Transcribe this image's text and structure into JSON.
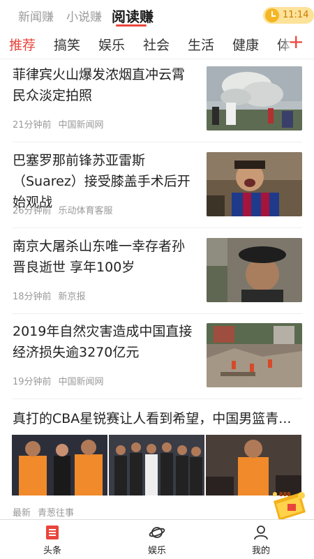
{
  "top_tabs": [
    "新闻赚",
    "小说赚",
    "阅读赚"
  ],
  "timer": {
    "time": "11:14"
  },
  "categories": [
    "推荐",
    "搞笑",
    "娱乐",
    "社会",
    "生活",
    "健康",
    "体"
  ],
  "add_symbol": "+",
  "articles": [
    {
      "title": "菲律宾火山爆发浓烟直冲云霄民众淡定拍照",
      "time": "21分钟前",
      "source": "中国新闻网"
    },
    {
      "title": "巴塞罗那前锋苏亚雷斯（Suarez）接受膝盖手术后开始观战",
      "time": "26分钟前",
      "source": "乐动体育客服"
    },
    {
      "title": "南京大屠杀山东唯一幸存者孙晋良逝世 享年100岁",
      "time": "18分钟前",
      "source": "新京报"
    },
    {
      "title": "2019年自然灾害造成中国直接经济损失逾3270亿元",
      "time": "19分钟前",
      "source": "中国新闻网"
    }
  ],
  "big_article": {
    "title": "真打的CBA星锐赛让人看到希望，中国男篮青...",
    "time": "最新",
    "source": "青葱往事"
  },
  "reward_badge": "888",
  "bottom_nav": [
    "头条",
    "娱乐",
    "我的"
  ],
  "colors": {
    "accent": "#e8453c",
    "timer_bg": "#fde29a",
    "muted": "#999999"
  }
}
